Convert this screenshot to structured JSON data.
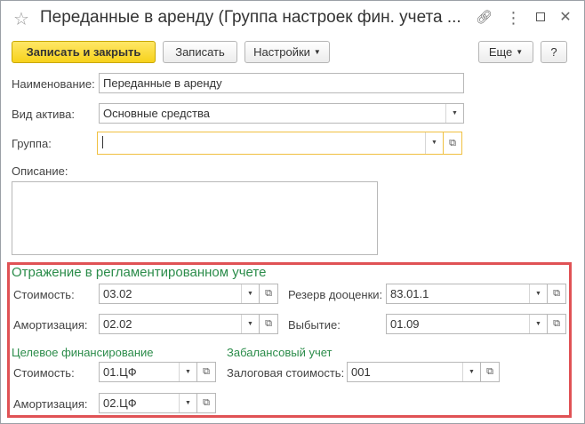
{
  "window": {
    "title": "Переданные в аренду (Группа настроек фин. учета ...",
    "icons": [
      "star-icon",
      "link-icon",
      "more-icon",
      "maximize-icon",
      "close-icon"
    ]
  },
  "toolbar": {
    "save_close_label": "Записать и закрыть",
    "save_label": "Записать",
    "settings_label": "Настройки",
    "more_label": "Еще",
    "help_label": "?"
  },
  "form": {
    "name_label": "Наименование:",
    "name_value": "Переданные в аренду",
    "asset_type_label": "Вид актива:",
    "asset_type_value": "Основные средства",
    "group_label": "Группа:",
    "group_value": "",
    "description_label": "Описание:",
    "description_value": ""
  },
  "regulated": {
    "section_title": "Отражение в регламентированном учете",
    "cost_label": "Стоимость:",
    "cost_value": "03.02",
    "amortization_label": "Амортизация:",
    "amortization_value": "02.02",
    "reserve_label": "Резерв дооценки:",
    "reserve_value": "83.01.1",
    "disposal_label": "Выбытие:",
    "disposal_value": "01.09"
  },
  "target_financing": {
    "section_title": "Целевое финансирование",
    "cost_label": "Стоимость:",
    "cost_value": "01.ЦФ",
    "amortization_label": "Амортизация:",
    "amortization_value": "02.ЦФ"
  },
  "off_balance": {
    "section_title": "Забалансовый учет",
    "pledge_label": "Залоговая стоимость:",
    "pledge_value": "001"
  },
  "colors": {
    "primary_button": "#f7d21b",
    "section_title": "#2b8c4a",
    "highlight_border": "#e05255",
    "focus_border": "#f0c040"
  }
}
